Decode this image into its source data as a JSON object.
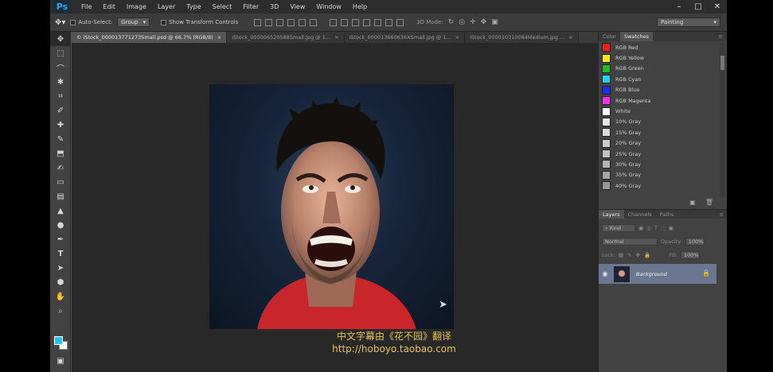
{
  "app": {
    "logo": "Ps"
  },
  "menu": [
    "File",
    "Edit",
    "Image",
    "Layer",
    "Type",
    "Select",
    "Filter",
    "3D",
    "View",
    "Window",
    "Help"
  ],
  "window_controls": {
    "minimize": "–",
    "restore": "□",
    "close": "✕"
  },
  "options": {
    "auto_select_label": "Auto-Select:",
    "auto_select_value": "Group",
    "transform_label": "Show Transform Controls",
    "mode3d_label": "3D Mode:",
    "workspace": "Painting"
  },
  "tabs": [
    {
      "label": "© iStock_000013771273Small.psd @ 66.7% (RGB/8)",
      "close": "×"
    },
    {
      "label": "iStock_000006520588Small.jpg @ 1...",
      "close": "×"
    },
    {
      "label": "iStock_000013660636XSmall.jpg @ 1...",
      "close": "×"
    },
    {
      "label": "iStock_000010310064Medium.jpg ...",
      "close": "×"
    }
  ],
  "watermark": {
    "line1": "中文字幕由《花不园》翻译",
    "line2": "http://hoboyo.taobao.com"
  },
  "swatches_panel": {
    "tabs": [
      "Color",
      "Swatches"
    ],
    "items": [
      {
        "name": "RGB Red",
        "color": "#ff1a1a"
      },
      {
        "name": "RGB Yellow",
        "color": "#ffea00"
      },
      {
        "name": "RGB Green",
        "color": "#19c11f"
      },
      {
        "name": "RGB Cyan",
        "color": "#16d6f0"
      },
      {
        "name": "RGB Blue",
        "color": "#1a2cff"
      },
      {
        "name": "RGB Magenta",
        "color": "#ff2cff"
      },
      {
        "name": "White",
        "color": "#ffffff"
      },
      {
        "name": "10% Gray",
        "color": "#e6e6e6"
      },
      {
        "name": "15% Gray",
        "color": "#d9d9d9"
      },
      {
        "name": "20% Gray",
        "color": "#cccccc"
      },
      {
        "name": "25% Gray",
        "color": "#bfbfbf"
      },
      {
        "name": "30% Gray",
        "color": "#b3b3b3"
      },
      {
        "name": "35% Gray",
        "color": "#a6a6a6"
      },
      {
        "name": "40% Gray",
        "color": "#999999"
      }
    ]
  },
  "layers_panel": {
    "tabs": [
      "Layers",
      "Channels",
      "Paths"
    ],
    "kind_label": "⌕ Kind",
    "blend_mode": "Normal",
    "opacity_label": "Opacity:",
    "opacity_value": "100%",
    "lock_label": "Lock:",
    "fill_label": "Fill:",
    "fill_value": "100%",
    "layer_name": "Background"
  }
}
